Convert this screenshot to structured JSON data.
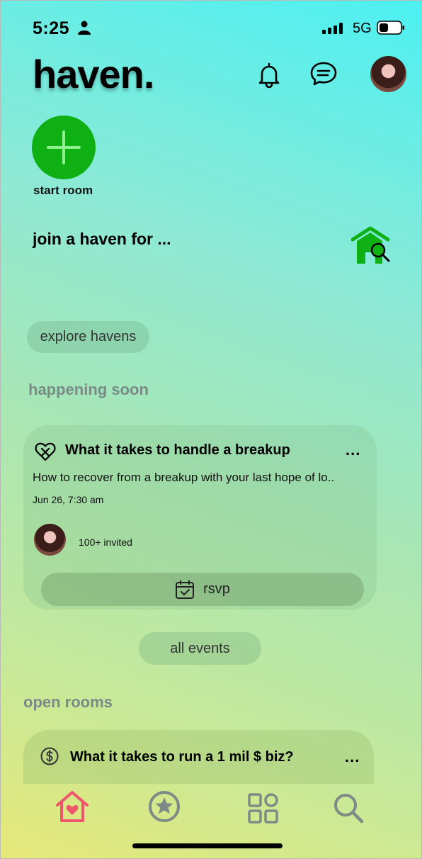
{
  "status_bar": {
    "time": "5:25",
    "network": "5G"
  },
  "header": {
    "logo": "haven."
  },
  "start_room": {
    "label": "start room"
  },
  "join": {
    "title": "join a haven for ..."
  },
  "explore": {
    "label": "explore havens"
  },
  "happening_soon": {
    "title": "happening soon",
    "event": {
      "title": "What it takes to handle a breakup",
      "menu": "...",
      "description": "How to recover from a breakup with your last hope of lo..",
      "date": "Jun 26, 7:30 am",
      "invited": "100+ invited",
      "rsvp_label": "rsvp"
    },
    "all_events_label": "all events"
  },
  "open_rooms": {
    "title": "open rooms",
    "room": {
      "title": "What it takes to run a 1 mil $ biz?",
      "menu": "..."
    }
  },
  "tab_bar": {
    "tabs": [
      {
        "icon": "home-heart-icon",
        "active": true
      },
      {
        "icon": "star-icon",
        "active": false
      },
      {
        "icon": "grid-icon",
        "active": false
      },
      {
        "icon": "search-icon",
        "active": false
      }
    ]
  },
  "colors": {
    "accent_green": "#0eb014",
    "active_tab": "#f0556e",
    "inactive_tab": "#7d8a86"
  }
}
